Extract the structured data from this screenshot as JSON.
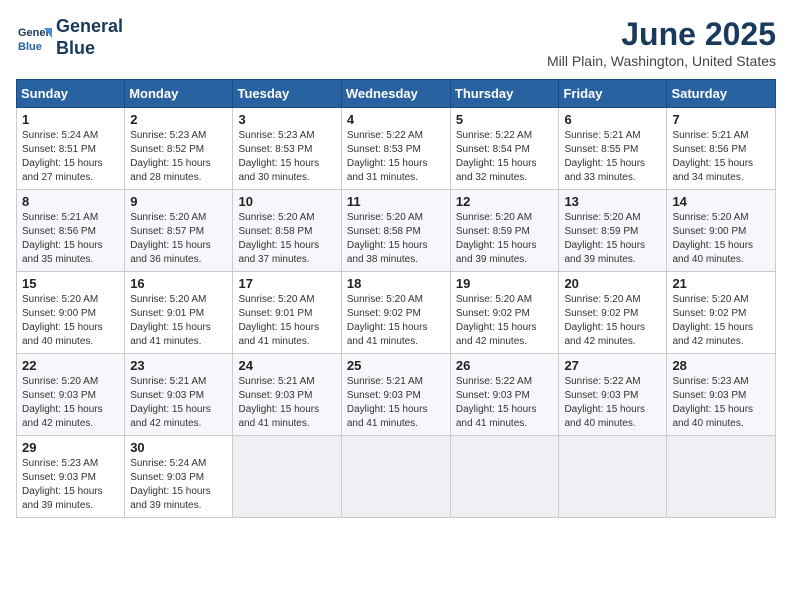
{
  "header": {
    "logo_line1": "General",
    "logo_line2": "Blue",
    "month": "June 2025",
    "location": "Mill Plain, Washington, United States"
  },
  "days_of_week": [
    "Sunday",
    "Monday",
    "Tuesday",
    "Wednesday",
    "Thursday",
    "Friday",
    "Saturday"
  ],
  "weeks": [
    [
      {
        "day": "1",
        "lines": [
          "Sunrise: 5:24 AM",
          "Sunset: 8:51 PM",
          "Daylight: 15 hours",
          "and 27 minutes."
        ]
      },
      {
        "day": "2",
        "lines": [
          "Sunrise: 5:23 AM",
          "Sunset: 8:52 PM",
          "Daylight: 15 hours",
          "and 28 minutes."
        ]
      },
      {
        "day": "3",
        "lines": [
          "Sunrise: 5:23 AM",
          "Sunset: 8:53 PM",
          "Daylight: 15 hours",
          "and 30 minutes."
        ]
      },
      {
        "day": "4",
        "lines": [
          "Sunrise: 5:22 AM",
          "Sunset: 8:53 PM",
          "Daylight: 15 hours",
          "and 31 minutes."
        ]
      },
      {
        "day": "5",
        "lines": [
          "Sunrise: 5:22 AM",
          "Sunset: 8:54 PM",
          "Daylight: 15 hours",
          "and 32 minutes."
        ]
      },
      {
        "day": "6",
        "lines": [
          "Sunrise: 5:21 AM",
          "Sunset: 8:55 PM",
          "Daylight: 15 hours",
          "and 33 minutes."
        ]
      },
      {
        "day": "7",
        "lines": [
          "Sunrise: 5:21 AM",
          "Sunset: 8:56 PM",
          "Daylight: 15 hours",
          "and 34 minutes."
        ]
      }
    ],
    [
      {
        "day": "8",
        "lines": [
          "Sunrise: 5:21 AM",
          "Sunset: 8:56 PM",
          "Daylight: 15 hours",
          "and 35 minutes."
        ]
      },
      {
        "day": "9",
        "lines": [
          "Sunrise: 5:20 AM",
          "Sunset: 8:57 PM",
          "Daylight: 15 hours",
          "and 36 minutes."
        ]
      },
      {
        "day": "10",
        "lines": [
          "Sunrise: 5:20 AM",
          "Sunset: 8:58 PM",
          "Daylight: 15 hours",
          "and 37 minutes."
        ]
      },
      {
        "day": "11",
        "lines": [
          "Sunrise: 5:20 AM",
          "Sunset: 8:58 PM",
          "Daylight: 15 hours",
          "and 38 minutes."
        ]
      },
      {
        "day": "12",
        "lines": [
          "Sunrise: 5:20 AM",
          "Sunset: 8:59 PM",
          "Daylight: 15 hours",
          "and 39 minutes."
        ]
      },
      {
        "day": "13",
        "lines": [
          "Sunrise: 5:20 AM",
          "Sunset: 8:59 PM",
          "Daylight: 15 hours",
          "and 39 minutes."
        ]
      },
      {
        "day": "14",
        "lines": [
          "Sunrise: 5:20 AM",
          "Sunset: 9:00 PM",
          "Daylight: 15 hours",
          "and 40 minutes."
        ]
      }
    ],
    [
      {
        "day": "15",
        "lines": [
          "Sunrise: 5:20 AM",
          "Sunset: 9:00 PM",
          "Daylight: 15 hours",
          "and 40 minutes."
        ]
      },
      {
        "day": "16",
        "lines": [
          "Sunrise: 5:20 AM",
          "Sunset: 9:01 PM",
          "Daylight: 15 hours",
          "and 41 minutes."
        ]
      },
      {
        "day": "17",
        "lines": [
          "Sunrise: 5:20 AM",
          "Sunset: 9:01 PM",
          "Daylight: 15 hours",
          "and 41 minutes."
        ]
      },
      {
        "day": "18",
        "lines": [
          "Sunrise: 5:20 AM",
          "Sunset: 9:02 PM",
          "Daylight: 15 hours",
          "and 41 minutes."
        ]
      },
      {
        "day": "19",
        "lines": [
          "Sunrise: 5:20 AM",
          "Sunset: 9:02 PM",
          "Daylight: 15 hours",
          "and 42 minutes."
        ]
      },
      {
        "day": "20",
        "lines": [
          "Sunrise: 5:20 AM",
          "Sunset: 9:02 PM",
          "Daylight: 15 hours",
          "and 42 minutes."
        ]
      },
      {
        "day": "21",
        "lines": [
          "Sunrise: 5:20 AM",
          "Sunset: 9:02 PM",
          "Daylight: 15 hours",
          "and 42 minutes."
        ]
      }
    ],
    [
      {
        "day": "22",
        "lines": [
          "Sunrise: 5:20 AM",
          "Sunset: 9:03 PM",
          "Daylight: 15 hours",
          "and 42 minutes."
        ]
      },
      {
        "day": "23",
        "lines": [
          "Sunrise: 5:21 AM",
          "Sunset: 9:03 PM",
          "Daylight: 15 hours",
          "and 42 minutes."
        ]
      },
      {
        "day": "24",
        "lines": [
          "Sunrise: 5:21 AM",
          "Sunset: 9:03 PM",
          "Daylight: 15 hours",
          "and 41 minutes."
        ]
      },
      {
        "day": "25",
        "lines": [
          "Sunrise: 5:21 AM",
          "Sunset: 9:03 PM",
          "Daylight: 15 hours",
          "and 41 minutes."
        ]
      },
      {
        "day": "26",
        "lines": [
          "Sunrise: 5:22 AM",
          "Sunset: 9:03 PM",
          "Daylight: 15 hours",
          "and 41 minutes."
        ]
      },
      {
        "day": "27",
        "lines": [
          "Sunrise: 5:22 AM",
          "Sunset: 9:03 PM",
          "Daylight: 15 hours",
          "and 40 minutes."
        ]
      },
      {
        "day": "28",
        "lines": [
          "Sunrise: 5:23 AM",
          "Sunset: 9:03 PM",
          "Daylight: 15 hours",
          "and 40 minutes."
        ]
      }
    ],
    [
      {
        "day": "29",
        "lines": [
          "Sunrise: 5:23 AM",
          "Sunset: 9:03 PM",
          "Daylight: 15 hours",
          "and 39 minutes."
        ]
      },
      {
        "day": "30",
        "lines": [
          "Sunrise: 5:24 AM",
          "Sunset: 9:03 PM",
          "Daylight: 15 hours",
          "and 39 minutes."
        ]
      },
      {
        "day": "",
        "lines": []
      },
      {
        "day": "",
        "lines": []
      },
      {
        "day": "",
        "lines": []
      },
      {
        "day": "",
        "lines": []
      },
      {
        "day": "",
        "lines": []
      }
    ]
  ]
}
